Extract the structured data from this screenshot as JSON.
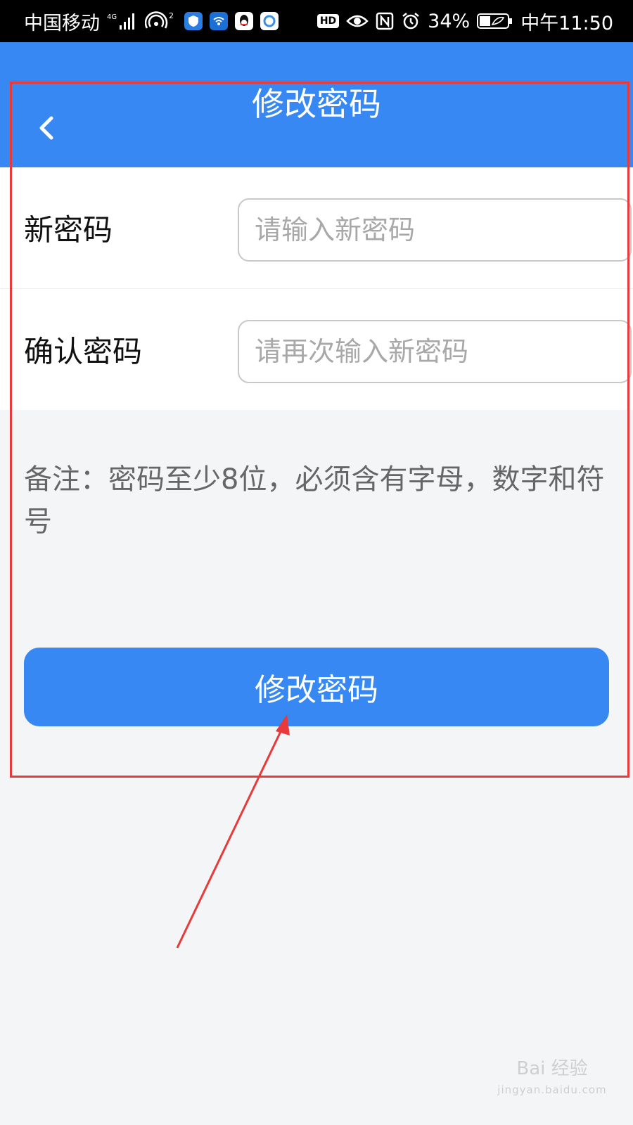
{
  "status_bar": {
    "carrier": "中国移动",
    "network": "4G",
    "hotspot_count": "2",
    "hd": "HD",
    "battery": "34%",
    "time": "中午11:50",
    "icons": [
      "signal-icon",
      "hotspot-icon",
      "shield-app-icon",
      "wifi-app-icon",
      "qq-app-icon",
      "browser-app-icon",
      "hd-icon",
      "eye-icon",
      "nfc-icon",
      "alarm-icon",
      "battery-icon"
    ]
  },
  "header": {
    "title": "修改密码",
    "back_icon": "chevron-left-icon",
    "bg_color": "#3788f2"
  },
  "form": {
    "fields": [
      {
        "label": "新密码",
        "placeholder": "请输入新密码",
        "value": ""
      },
      {
        "label": "确认密码",
        "placeholder": "请再次输入新密码",
        "value": ""
      }
    ]
  },
  "note": "备注：密码至少8位，必须含有字母，数字和符号",
  "submit_label": "修改密码",
  "annotation": {
    "highlight_color": "#e83a3a"
  },
  "watermark": {
    "brand": "Bai 经验",
    "url": "jingyan.baidu.com"
  }
}
